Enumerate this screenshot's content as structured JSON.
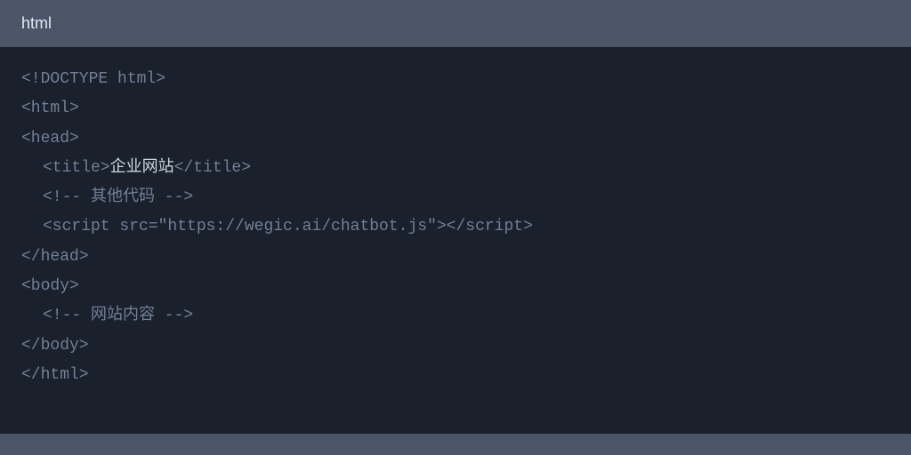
{
  "header": {
    "language": "html"
  },
  "code": {
    "line1": "<!DOCTYPE html>",
    "line2": "<html>",
    "line3": "<head>",
    "line4_open": "<title>",
    "line4_text": "企业网站",
    "line4_close": "</title>",
    "line5": "<!-- 其他代码 -->",
    "line6": "<script src=\"https://wegic.ai/chatbot.js\"></script>",
    "line7": "</head>",
    "line8": "<body>",
    "line9": "<!-- 网站内容 -->",
    "line10": "</body>",
    "line11": "</html>"
  }
}
